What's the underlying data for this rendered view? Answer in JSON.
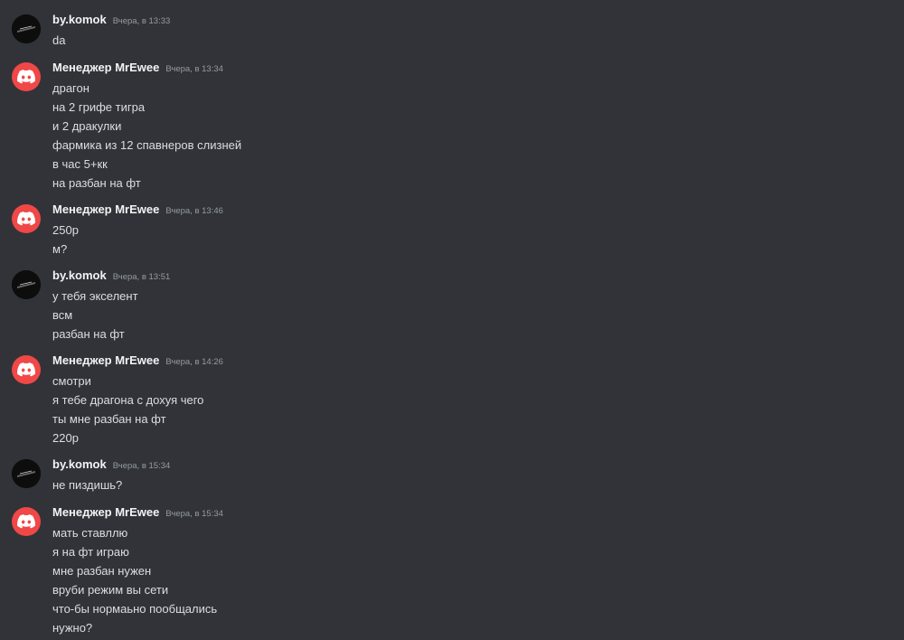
{
  "messages": [
    {
      "author": "by.komok",
      "avatar": "user-avatar",
      "timestamp": "Вчера, в 13:33",
      "lines": [
        "da"
      ]
    },
    {
      "author": "Менеджер MrEwee",
      "avatar": "discord-icon",
      "timestamp": "Вчера, в 13:34",
      "lines": [
        "драгон",
        "на 2 грифе тигра",
        "и 2 дракулки",
        "фармика из 12 спавнеров слизней",
        "в час 5+кк",
        "на разбан на фт"
      ]
    },
    {
      "author": "Менеджер MrEwee",
      "avatar": "discord-icon",
      "timestamp": "Вчера, в 13:46",
      "lines": [
        "250р",
        "м?"
      ]
    },
    {
      "author": "by.komok",
      "avatar": "user-avatar",
      "timestamp": "Вчера, в 13:51",
      "lines": [
        "у тебя экселент",
        "всм",
        "разбан на фт"
      ]
    },
    {
      "author": "Менеджер MrEwee",
      "avatar": "discord-icon",
      "timestamp": "Вчера, в 14:26",
      "lines": [
        "смотри",
        "я тебе драгона с дохуя чего",
        "ты мне разбан на фт",
        "220р"
      ]
    },
    {
      "author": "by.komok",
      "avatar": "user-avatar",
      "timestamp": "Вчера, в 15:34",
      "lines": [
        "не пиздишь?"
      ]
    },
    {
      "author": "Менеджер MrEwee",
      "avatar": "discord-icon",
      "timestamp": "Вчера, в 15:34",
      "lines": [
        "мать ставллю",
        "я на фт играю",
        "мне разбан нужен",
        "вруби режим вы сети",
        "что-бы нормаьно пообщались",
        "нужно?"
      ]
    }
  ],
  "colors": {
    "background": "#313338",
    "discord_avatar": "#f04747",
    "username": "#f2f3f5",
    "timestamp": "#949ba4",
    "message_text": "#dbdee1"
  }
}
